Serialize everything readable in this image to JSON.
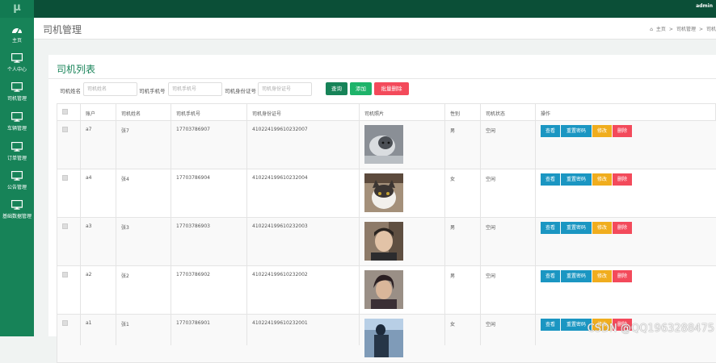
{
  "app": {
    "logo": "μ",
    "user": "admin"
  },
  "sidebar": {
    "items": [
      {
        "label": "主页",
        "icon": "dashboard-icon"
      },
      {
        "label": "个人中心",
        "icon": "monitor-icon"
      },
      {
        "label": "司机管理",
        "icon": "monitor-icon"
      },
      {
        "label": "车辆管理",
        "icon": "monitor-icon"
      },
      {
        "label": "订单管理",
        "icon": "monitor-icon"
      },
      {
        "label": "公告管理",
        "icon": "monitor-icon"
      },
      {
        "label": "基础数据管理",
        "icon": "monitor-icon"
      }
    ]
  },
  "header": {
    "title": "司机管理",
    "breadcrumb": [
      "主页",
      ">",
      "司机管理",
      ">",
      "司机"
    ]
  },
  "card": {
    "title": "司机列表"
  },
  "search": {
    "name_label": "司机姓名",
    "name_placeholder": "司机姓名",
    "phone_label": "司机手机号",
    "phone_placeholder": "司机手机号",
    "id_label": "司机身份证号",
    "id_placeholder": "司机身份证号"
  },
  "buttons": {
    "query": "查询",
    "add": "添加",
    "batch_delete": "批量删除"
  },
  "table": {
    "columns": [
      "账户",
      "司机姓名",
      "司机手机号",
      "司机身份证号",
      "司机照片",
      "性别",
      "司机状态",
      "操作"
    ],
    "actions": {
      "view": "查看",
      "reset": "重置密码",
      "edit": "修改",
      "delete": "删除"
    },
    "rows": [
      {
        "account": "a7",
        "name": "张7",
        "phone": "17703786907",
        "idcard": "410224199610232007",
        "gender": "男",
        "status": "空闲",
        "photo": "husky-photo"
      },
      {
        "account": "a4",
        "name": "张4",
        "phone": "17703786904",
        "idcard": "410224199610232004",
        "gender": "女",
        "status": "空闲",
        "photo": "cat-photo"
      },
      {
        "account": "a3",
        "name": "张3",
        "phone": "17703786903",
        "idcard": "410224199610232003",
        "gender": "男",
        "status": "空闲",
        "photo": "man-photo"
      },
      {
        "account": "a2",
        "name": "张2",
        "phone": "17703786902",
        "idcard": "410224199610232002",
        "gender": "男",
        "status": "空闲",
        "photo": "man-dark-photo"
      },
      {
        "account": "a1",
        "name": "张1",
        "phone": "17703786901",
        "idcard": "410224199610232001",
        "gender": "女",
        "status": "空闲",
        "photo": "landscape-photo"
      }
    ]
  },
  "watermark": "CSDN @QQ1963288475",
  "colors": {
    "topbar": "#0b4f37",
    "sidebar": "#178358",
    "accent": "#178358",
    "view": "#1b96c2",
    "edit": "#f0ad1e",
    "delete": "#f34a5b",
    "query": "#178358",
    "add": "#1eb36a",
    "batch_delete": "#f34a5b"
  }
}
